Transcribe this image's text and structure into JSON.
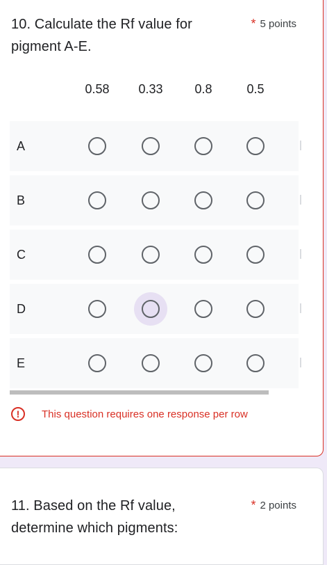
{
  "q10": {
    "title": "10. Calculate the Rf  value for pigment A-E.",
    "required_mark": "*",
    "points": "5 points",
    "columns": [
      "0.58",
      "0.33",
      "0.8",
      "0.5"
    ],
    "rows": [
      "A",
      "B",
      "C",
      "D",
      "E"
    ],
    "error": "This question requires one response per row",
    "error_icon": "!"
  },
  "q11": {
    "title": "11. Based on the Rf value, determine which pigments:",
    "required_mark": "*",
    "points": "2 points"
  },
  "colors": {
    "error": "#d93025",
    "hover": "#e7e0f3",
    "row_bg": "#f8f9fa",
    "page_bg": "#efe9f8"
  }
}
